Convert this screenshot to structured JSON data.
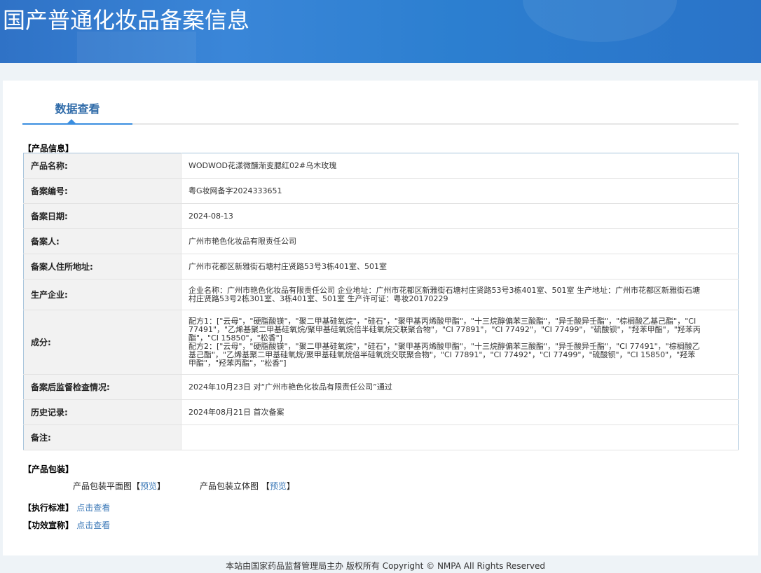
{
  "header": {
    "title": "国产普通化妆品备案信息"
  },
  "tabs": [
    {
      "label": "数据查看",
      "active": true
    }
  ],
  "product_info": {
    "section_label": "【产品信息】",
    "rows": [
      {
        "label": "产品名称:",
        "value": "WODWOD花漾微醺渐变腮红02#乌木玫瑰"
      },
      {
        "label": "备案编号:",
        "value": "粤G妆网备字2024333651"
      },
      {
        "label": "备案日期:",
        "value": "2024-08-13"
      },
      {
        "label": "备案人:",
        "value": "广州市艳色化妆品有限责任公司"
      },
      {
        "label": "备案人住所地址:",
        "value": "广州市花都区新雅街石塘村庄贤路53号3栋401室、501室"
      },
      {
        "label": "生产企业:",
        "value": "企业名称：广州市艳色化妆品有限责任公司 企业地址：广州市花都区新雅街石塘村庄贤路53号3栋401室、501室 生产地址：广州市花都区新雅街石塘村庄贤路53号2栋301室、3栋401室、501室 生产许可证：粤妆20170229"
      },
      {
        "label": "成分:",
        "value": "",
        "formulas": [
          "配方1：[\"云母\"，\"硬脂酸镁\"，\"聚二甲基硅氧烷\"，\"硅石\"，\"聚甲基丙烯酸甲酯\"，\"十三烷醇偏苯三酸酯\"，\"异壬酸异壬酯\"，\"棕榈酸乙基己酯\"，\"CI 77491\"，\"乙烯基聚二甲基硅氧烷/聚甲基硅氧烷倍半硅氧烷交联聚合物\"，\"CI 77891\"，\"CI 77492\"，\"CI 77499\"，\"硫酸钡\"，\"羟苯甲酯\"，\"羟苯丙酯\"，\"CI 15850\"，\"松香\"]",
          "配方2：[\"云母\"，\"硬脂酸镁\"，\"聚二甲基硅氧烷\"，\"硅石\"，\"聚甲基丙烯酸甲酯\"，\"十三烷醇偏苯三酸酯\"，\"异壬酸异壬酯\"，\"CI 77491\"，\"棕榈酸乙基己酯\"，\"乙烯基聚二甲基硅氧烷/聚甲基硅氧烷倍半硅氧烷交联聚合物\"，\"CI 77891\"，\"CI 77492\"，\"CI 77499\"，\"硫酸钡\"，\"CI 15850\"，\"羟苯甲酯\"，\"羟苯丙酯\"，\"松香\"]"
        ]
      },
      {
        "label": "备案后监督检查情况:",
        "value": "2024年10月23日 对“广州市艳色化妆品有限责任公司”通过"
      },
      {
        "label": "历史记录:",
        "value": "2024年08月21日 首次备案"
      },
      {
        "label": "备注:",
        "value": ""
      }
    ]
  },
  "packaging": {
    "section_label": "【产品包装】",
    "flat_label": "产品包装平面图",
    "flat_link": "预览",
    "solid_label": "产品包装立体图",
    "solid_link": "预览",
    "bracket_open": "【",
    "bracket_close": "】"
  },
  "standard": {
    "label": "【执行标准】",
    "link": "点击查看"
  },
  "claims": {
    "label": "【功效宣称】",
    "link": "点击查看"
  },
  "footer": {
    "text": "本站由国家药品监督管理局主办 版权所有 Copyright © NMPA All Rights Reserved"
  }
}
